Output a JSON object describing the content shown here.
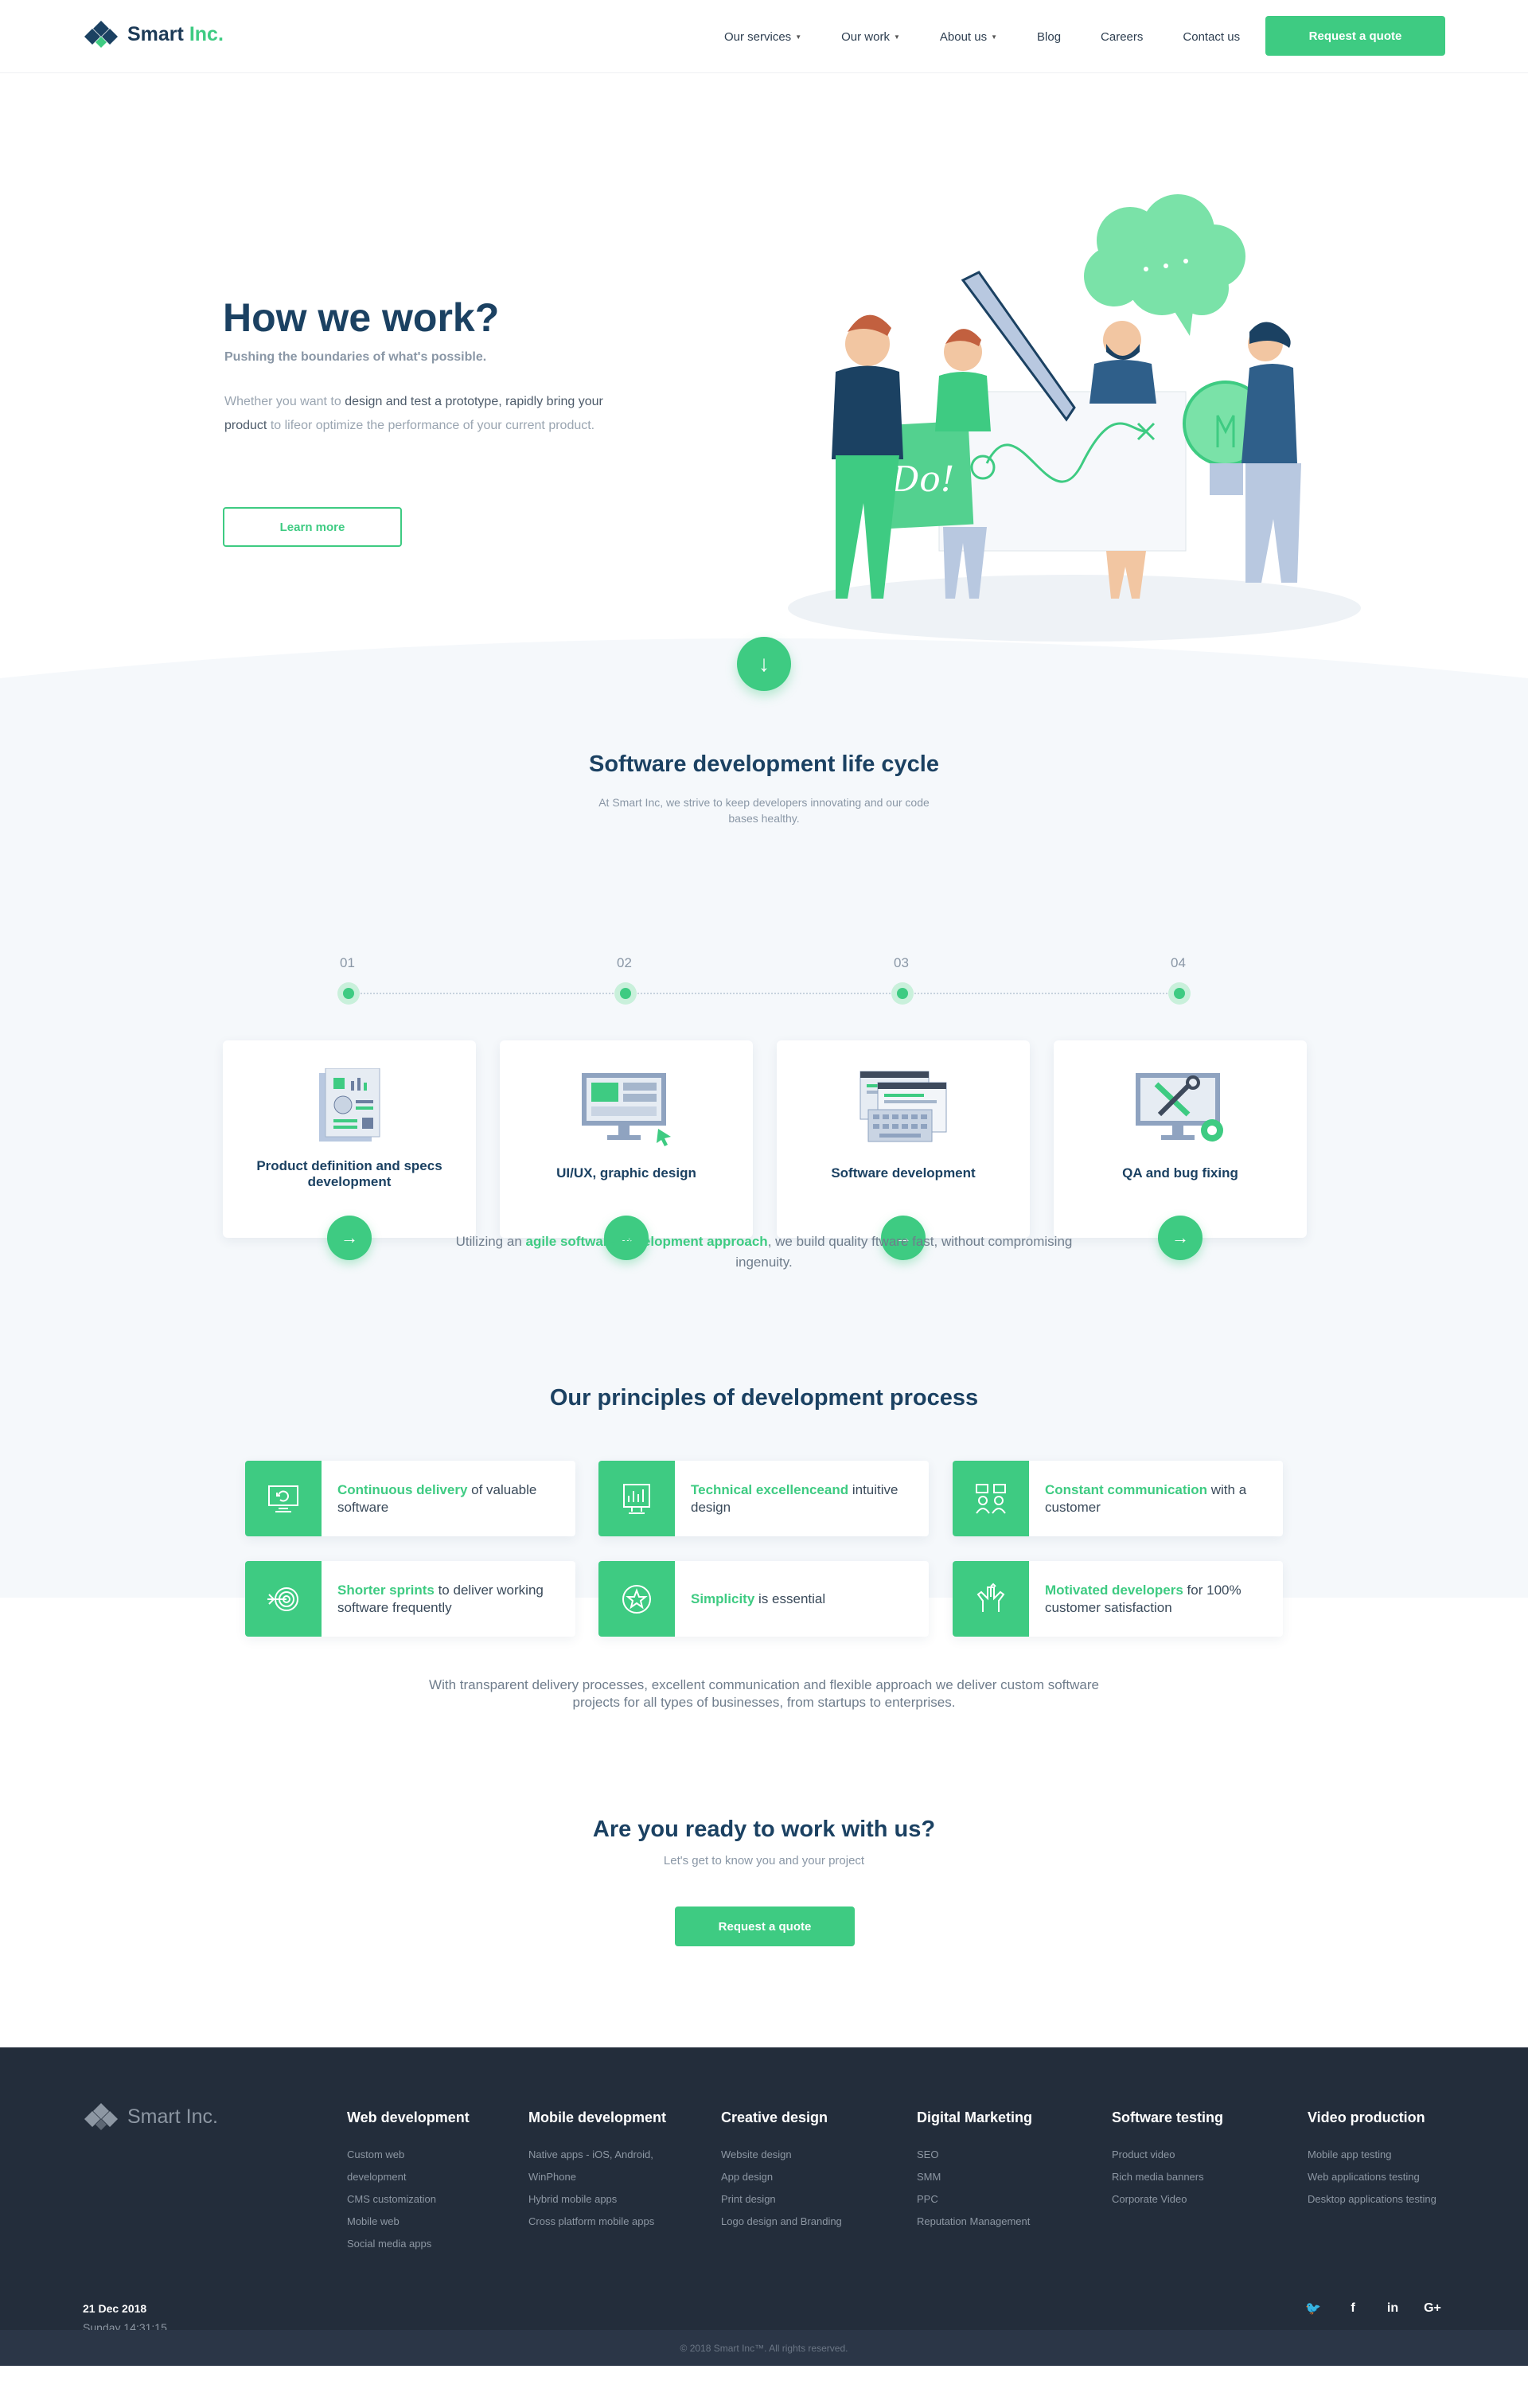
{
  "header": {
    "brand_main": "Smart",
    "brand_accent": "Inc.",
    "nav": [
      {
        "label": "Our services"
      },
      {
        "label": "Our work"
      },
      {
        "label": "About us"
      },
      {
        "label": "Blog"
      },
      {
        "label": "Careers"
      },
      {
        "label": "Contact us"
      }
    ],
    "cta_label": "Request a quote"
  },
  "hero": {
    "title": "How we work?",
    "subtitle": "Pushing the boundaries of what's possible.",
    "body_1": "Whether you want to ",
    "body_bold_1": "design and test a prototype, rapidly bring your product",
    "body_2": " to lifeor optimize the performance of your current product.",
    "button_label": "Learn more",
    "illustration_sign": "Do!"
  },
  "lifecycle": {
    "title": "Software development life cycle",
    "subtitle": "At Smart Inc, we strive to keep developers innovating and our code bases healthy.",
    "steps": [
      {
        "num": "01",
        "title": "Product definition and specs development",
        "icon": "specs-document-icon"
      },
      {
        "num": "02",
        "title": "UI/UX, graphic design",
        "icon": "design-monitor-icon"
      },
      {
        "num": "03",
        "title": "Software development",
        "icon": "code-windows-icon"
      },
      {
        "num": "04",
        "title": "QA and bug fixing",
        "icon": "tools-monitor-icon"
      }
    ],
    "agile_before": "Utilizing an ",
    "agile_highlight": "agile software development approach",
    "agile_after": ", we build quality ftware fast, without compromising ingenuity."
  },
  "principles": {
    "title": "Our principles of development process",
    "items": [
      {
        "highlight": "Continuous delivery",
        "rest": " of valuable software",
        "icon": "monitor-refresh-icon"
      },
      {
        "highlight": "Technical excellenceand",
        "rest": " intuitive design",
        "icon": "chart-screen-icon"
      },
      {
        "highlight": "Constant communication",
        "rest": " with a customer",
        "icon": "people-chat-icon"
      },
      {
        "highlight": "Shorter sprints",
        "rest": " to deliver working software frequently",
        "icon": "target-icon"
      },
      {
        "highlight": "Simplicity",
        "rest": " is essential",
        "icon": "star-circle-icon"
      },
      {
        "highlight": "Motivated developers",
        "rest": " for 100% customer satisfaction",
        "icon": "hands-icon"
      }
    ]
  },
  "closing": {
    "text": "With transparent delivery processes, excellent communication and flexible approach we deliver custom software projects for all types of businesses, from startups to enterprises.",
    "cta_title": "Are you ready to work with us?",
    "cta_subtitle": "Let's get to know you and your project",
    "cta_button": "Request a quote"
  },
  "footer": {
    "brand": "Smart Inc.",
    "columns": [
      {
        "title": "Web development",
        "links": [
          "Custom web",
          "development",
          "CMS customization",
          "Mobile web",
          "Social media apps"
        ]
      },
      {
        "title": "Mobile development",
        "links": [
          "Native apps - iOS, Android,",
          "WinPhone",
          "Hybrid mobile apps",
          "Cross platform mobile apps"
        ]
      },
      {
        "title": "Creative design",
        "links": [
          "Website design",
          "App design",
          "Print design",
          "Logo design and Branding"
        ]
      },
      {
        "title": "Digital Marketing",
        "links": [
          "SEO",
          "SMM",
          "PPC",
          "Reputation Management"
        ]
      },
      {
        "title": "Software testing",
        "links": [
          "Product video",
          "Rich media banners",
          "Corporate Video"
        ]
      },
      {
        "title": "Video production",
        "links": [
          "Mobile app testing",
          "Web applications testing",
          "Desktop applications testing"
        ]
      }
    ],
    "date": "21 Dec 2018",
    "time": "Sunday 14:31:15",
    "socials": [
      {
        "name": "twitter-icon",
        "glyph": "🐦"
      },
      {
        "name": "facebook-icon",
        "glyph": "f"
      },
      {
        "name": "linkedin-icon",
        "glyph": "in"
      },
      {
        "name": "google-plus-icon",
        "glyph": "G+"
      }
    ],
    "copyright": "© 2018 Smart Inc™. All rights reserved."
  },
  "colors": {
    "accent": "#3ecb82",
    "navy": "#1b4162",
    "footer": "#232d3b",
    "band": "#f5f8fb"
  }
}
